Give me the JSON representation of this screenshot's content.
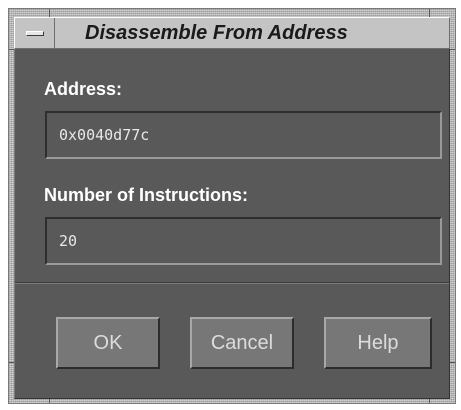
{
  "window": {
    "title": "Disassemble From Address"
  },
  "fields": {
    "address_label": "Address:",
    "address_value": "0x0040d77c",
    "count_label": "Number of Instructions:",
    "count_value": "20"
  },
  "buttons": {
    "ok_label": "OK",
    "cancel_label": "Cancel",
    "help_label": "Help"
  },
  "icons": {
    "window_menu": "window-menu-icon"
  },
  "colors": {
    "dialog_background": "#595959",
    "title_bar": "#c4c4c4",
    "button_face": "#777777"
  }
}
